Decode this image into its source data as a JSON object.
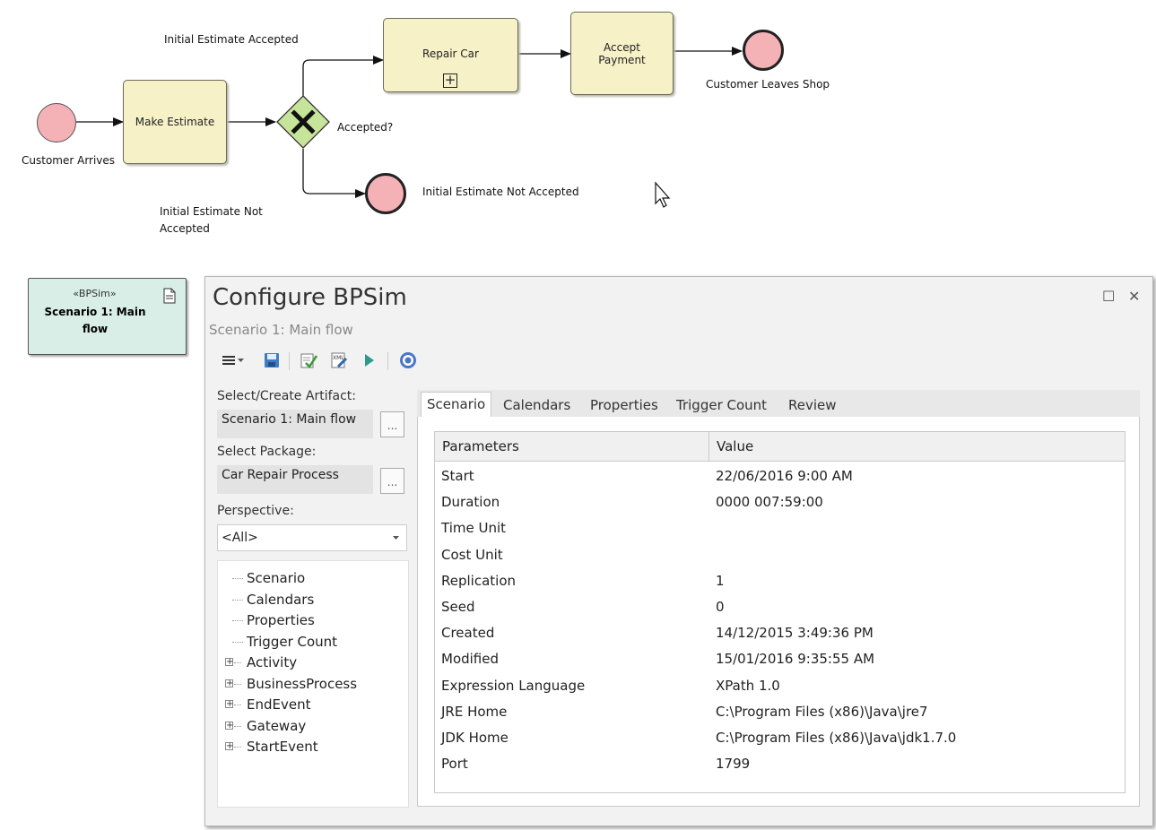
{
  "diagram": {
    "labels": {
      "initial_estimate_accepted": "Initial Estimate Accepted",
      "customer_arrives": "Customer Arrives",
      "make_estimate": "Make Estimate",
      "accepted_q": "Accepted?",
      "initial_estimate_not_accepted_flow": "Initial Estimate Not Accepted",
      "initial_estimate_not_accepted_event": "Initial Estimate Not Accepted",
      "repair_car": "Repair Car",
      "accept_payment": "Accept Payment",
      "customer_leaves_shop": "Customer Leaves Shop"
    },
    "artifact": {
      "stereotype": "«BPSim»",
      "name": "Scenario 1: Main flow"
    }
  },
  "window": {
    "title": "Configure BPSim",
    "subtitle": "Scenario 1: Main flow",
    "maximize_glyph": "☐",
    "close_glyph": "✕",
    "toolbar_icons": [
      "menu-icon",
      "save-icon",
      "validate-icon",
      "export-xml-icon",
      "run-icon",
      "help-icon"
    ],
    "left": {
      "select_artifact_label": "Select/Create Artifact:",
      "select_artifact_value": "Scenario 1: Main flow",
      "select_package_label": "Select Package:",
      "select_package_value": "Car Repair Process",
      "perspective_label": "Perspective:",
      "perspective_value": "<All>",
      "browse_button_label": "...",
      "tree": [
        {
          "label": "Scenario",
          "expandable": false
        },
        {
          "label": "Calendars",
          "expandable": false
        },
        {
          "label": "Properties",
          "expandable": false
        },
        {
          "label": "Trigger Count",
          "expandable": false
        },
        {
          "label": "Activity",
          "expandable": true
        },
        {
          "label": "BusinessProcess",
          "expandable": true
        },
        {
          "label": "EndEvent",
          "expandable": true
        },
        {
          "label": "Gateway",
          "expandable": true
        },
        {
          "label": "StartEvent",
          "expandable": true
        }
      ]
    },
    "tabs": [
      "Scenario",
      "Calendars",
      "Properties",
      "Trigger Count",
      "Review"
    ],
    "active_tab": "Scenario",
    "grid": {
      "headers": [
        "Parameters",
        "Value"
      ],
      "rows": [
        {
          "param": "Start",
          "value": "22/06/2016 9:00 AM"
        },
        {
          "param": "Duration",
          "value": "0000 007:59:00"
        },
        {
          "param": "Time Unit",
          "value": ""
        },
        {
          "param": "Cost Unit",
          "value": ""
        },
        {
          "param": "Replication",
          "value": "1"
        },
        {
          "param": "Seed",
          "value": "0"
        },
        {
          "param": "Created",
          "value": "14/12/2015 3:49:36 PM"
        },
        {
          "param": "Modified",
          "value": "15/01/2016 9:35:55 AM"
        },
        {
          "param": "Expression Language",
          "value": "XPath 1.0"
        },
        {
          "param": "JRE Home",
          "value": "C:\\Program Files (x86)\\Java\\jre7"
        },
        {
          "param": "JDK Home",
          "value": "C:\\Program Files (x86)\\Java\\jdk1.7.0"
        },
        {
          "param": "Port",
          "value": "1799"
        }
      ]
    }
  },
  "colors": {
    "task_fill": "#f7f1c8",
    "event_fill": "#f5b2b6",
    "gateway_fill": "#c6e59a",
    "artifact_fill": "#d8eee6"
  }
}
